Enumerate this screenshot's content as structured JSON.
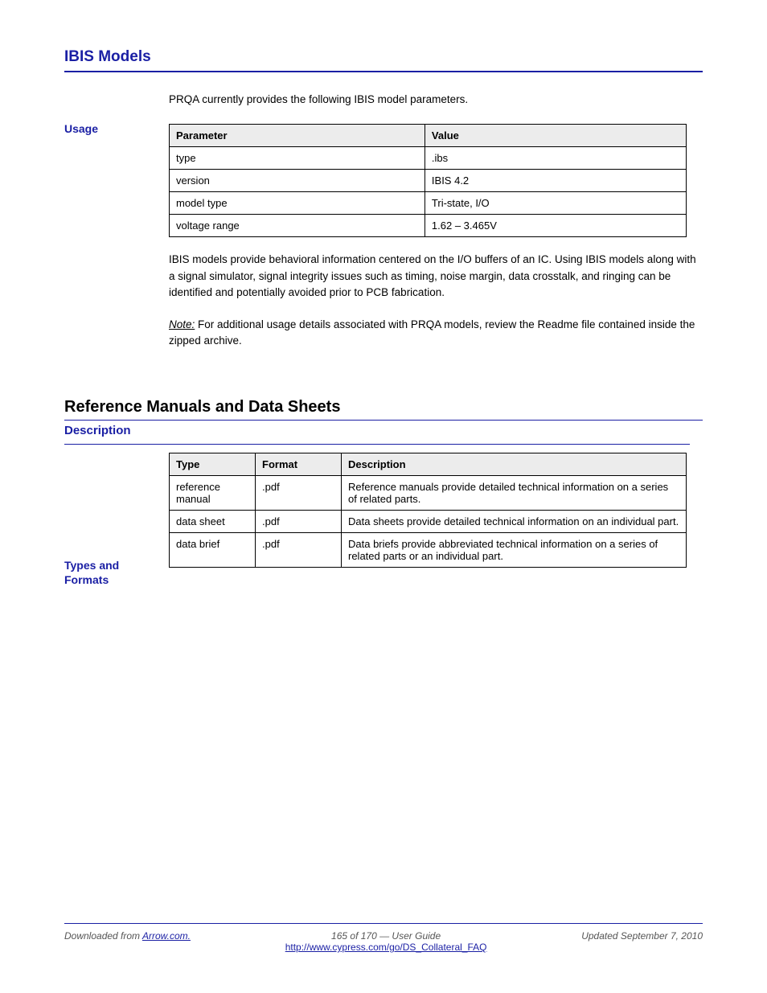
{
  "topHeading": "IBIS Models",
  "sideHeading1": "Usage",
  "table1": {
    "headers": [
      "Parameter",
      "Value"
    ],
    "rows": [
      [
        "type",
        ".ibs"
      ],
      [
        "version",
        "IBIS 4.2"
      ],
      [
        "model type",
        "Tri-state, I/O"
      ],
      [
        "voltage range",
        "1.62 – 3.465V"
      ]
    ]
  },
  "para1": "IBIS models provide behavioral information centered on the I/O buffers of an IC. Using IBIS models along with a signal simulator, signal integrity issues such as timing, noise margin, data crosstalk, and ringing can be identified and potentially avoided prior to PCB fabrication.",
  "note": "Note:",
  "noteBody": " For additional usage details associated with PRQA models, review the Readme file contained inside the zipped archive.",
  "sectionHeading": "Reference Manuals and Data Sheets",
  "sectionSub": "Description",
  "sideHeading2": "Types and Formats",
  "table2": {
    "headers": [
      "Type",
      "Format",
      "Description"
    ],
    "rows": [
      [
        "reference manual",
        ".pdf",
        "Reference manuals provide detailed technical information on a series of related parts."
      ],
      [
        "data sheet",
        ".pdf",
        "Data sheets provide detailed technical information on an individual part."
      ],
      [
        "data brief",
        ".pdf",
        "Data briefs provide abbreviated technical information on a series of related parts or an individual part."
      ]
    ]
  },
  "footer": {
    "left": "Downloaded from",
    "centerTop": "165 of 170 — User Guide",
    "centerBottom": "http://www.cypress.com/go/DS_Collateral_FAQ",
    "right": "Updated September 7, 2010"
  }
}
